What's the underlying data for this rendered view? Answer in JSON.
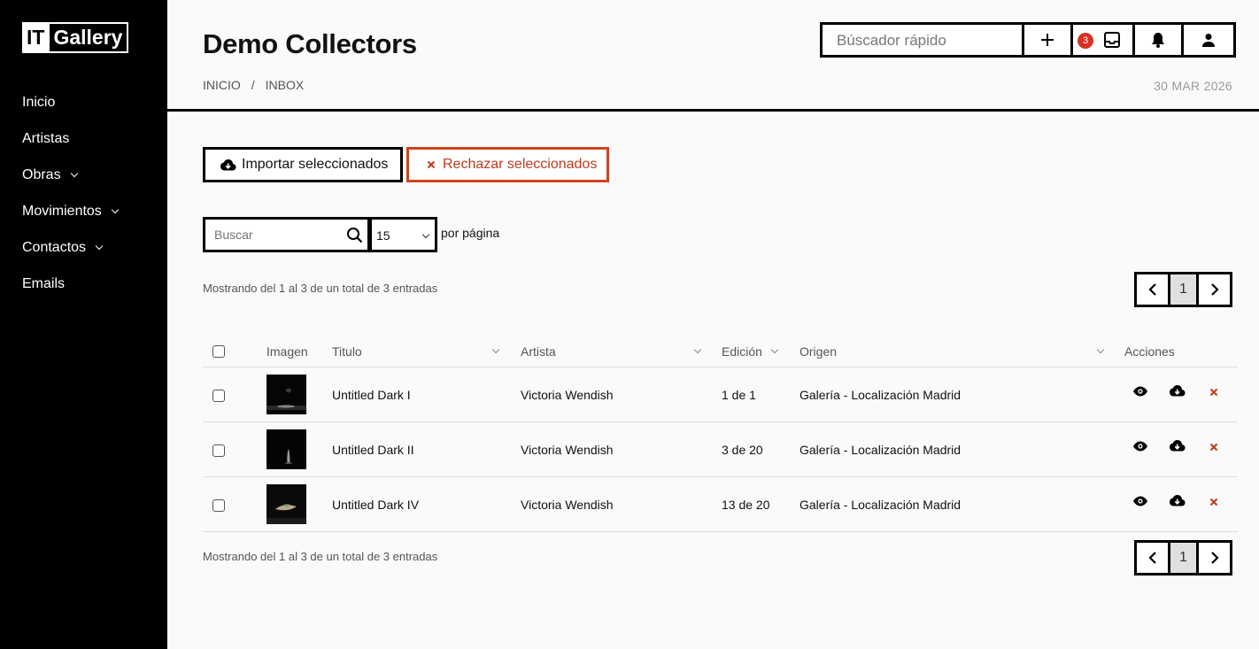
{
  "app": {
    "logo_it": "IT",
    "logo_gallery": "Gallery"
  },
  "sidebar": {
    "items": [
      {
        "label": "Inicio",
        "has_chevron": false
      },
      {
        "label": "Artistas",
        "has_chevron": false
      },
      {
        "label": "Obras",
        "has_chevron": true
      },
      {
        "label": "Movimientos",
        "has_chevron": true
      },
      {
        "label": "Contactos",
        "has_chevron": true
      },
      {
        "label": "Emails",
        "has_chevron": false
      }
    ]
  },
  "header": {
    "title": "Demo Collectors",
    "breadcrumb": {
      "home": "INICIO",
      "separator": "/",
      "current": "INBOX"
    },
    "date": "30 MAR 2026",
    "quick_search_placeholder": "Búscador rápido",
    "inbox_badge": "3"
  },
  "actions": {
    "import_label": "Importar seleccionados",
    "reject_label": "Rechazar seleccionados"
  },
  "filters": {
    "search_placeholder": "Buscar",
    "per_page_value": "15",
    "per_page_label": "por página"
  },
  "info_top": "Mostrando del 1 al 3 de un total de 3 entradas",
  "info_bottom": "Mostrando del 1 al 3 de un total de 3 entradas",
  "pagination": {
    "current_page": "1"
  },
  "table": {
    "headers": {
      "imagen": "Imagen",
      "titulo": "Titulo",
      "artista": "Artista",
      "edicion": "Edición",
      "origen": "Origen",
      "acciones": "Acciones"
    },
    "rows": [
      {
        "title": "Untitled Dark I",
        "artist": "Victoria Wendish",
        "edition": "1 de 1",
        "origin": "Galería - Localización Madrid"
      },
      {
        "title": "Untitled Dark II",
        "artist": "Victoria Wendish",
        "edition": "3 de 20",
        "origin": "Galería - Localización Madrid"
      },
      {
        "title": "Untitled Dark IV",
        "artist": "Victoria Wendish",
        "edition": "13 de 20",
        "origin": "Galería - Localización Madrid"
      }
    ]
  },
  "colors": {
    "accent_red": "#d0431f",
    "sidebar_bg": "#000000",
    "badge_red": "#d93025"
  }
}
